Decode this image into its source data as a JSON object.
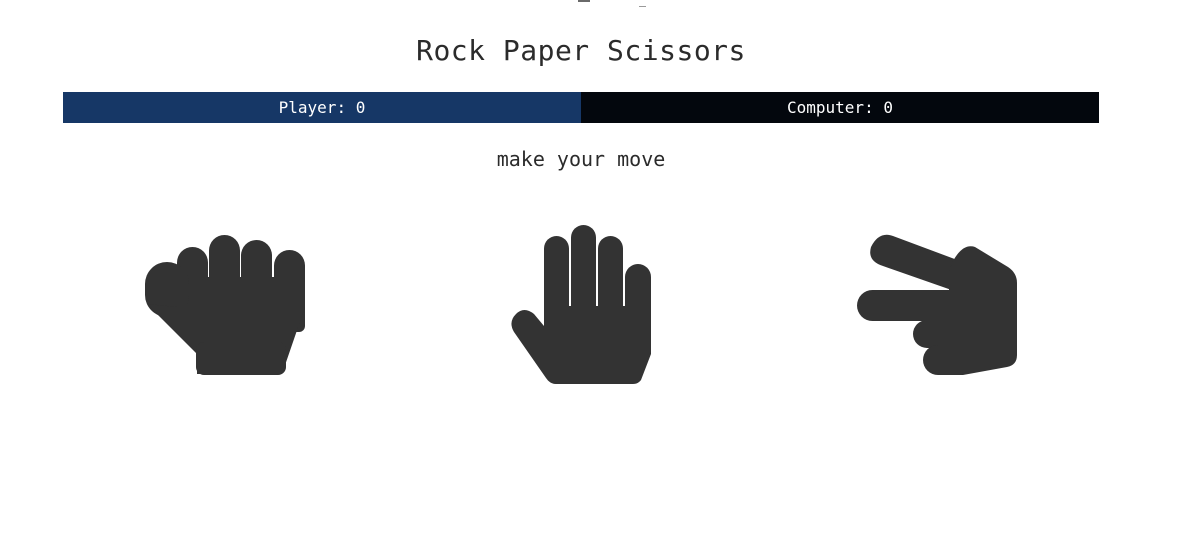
{
  "title": "Rock Paper Scissors",
  "scoreboard": {
    "player_label": "Player:",
    "player_score": "0",
    "computer_label": "Computer:",
    "computer_score": "0"
  },
  "prompt": "make your move",
  "choices": [
    {
      "name": "rock",
      "icon": "hand-rock-icon"
    },
    {
      "name": "paper",
      "icon": "hand-paper-icon"
    },
    {
      "name": "scissors",
      "icon": "hand-scissors-icon"
    }
  ],
  "colors": {
    "player_bar": "#163766",
    "computer_bar": "#03070d",
    "icon": "#333333",
    "text": "#2b2b2b"
  }
}
